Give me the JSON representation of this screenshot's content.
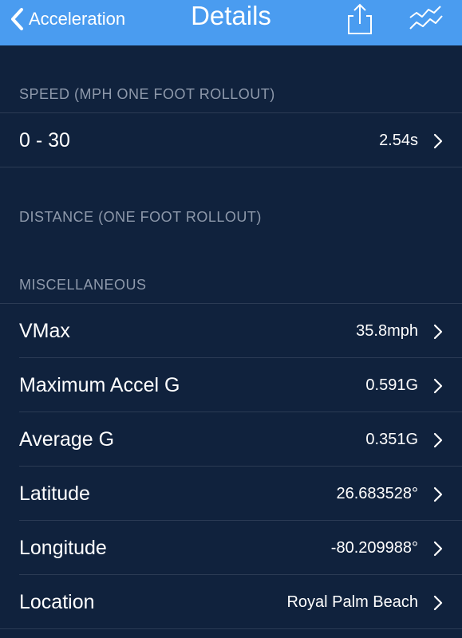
{
  "nav": {
    "back_label": "Acceleration",
    "title": "Details",
    "back_icon": "chevron-left-icon",
    "share_icon": "share-icon",
    "chart_icon": "chart-icon",
    "bar_color": "#4a9cf0"
  },
  "sections": {
    "speed": {
      "header": "SPEED (MPH ONE FOOT ROLLOUT)",
      "rows": [
        {
          "label": "0 - 30",
          "value": "2.54s"
        }
      ]
    },
    "distance": {
      "header": "DISTANCE (ONE FOOT ROLLOUT)"
    },
    "misc": {
      "header": "MISCELLANEOUS",
      "rows": [
        {
          "label": "VMax",
          "value": "35.8mph"
        },
        {
          "label": "Maximum Accel G",
          "value": "0.591G"
        },
        {
          "label": "Average G",
          "value": "0.351G"
        },
        {
          "label": "Latitude",
          "value": "26.683528°"
        },
        {
          "label": "Longitude",
          "value": "-80.209988°"
        },
        {
          "label": "Location",
          "value": "Royal Palm Beach"
        }
      ]
    }
  },
  "colors": {
    "background": "#10223d",
    "header_text": "#8e99ab",
    "divider": "#2b3b54"
  }
}
